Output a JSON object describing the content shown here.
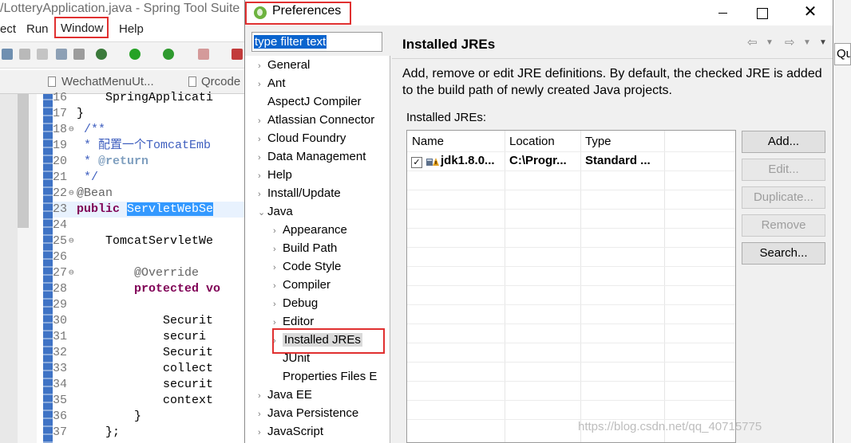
{
  "ide": {
    "title": "/LotteryApplication.java - Spring Tool Suite",
    "menu": [
      "ect",
      "Run",
      "Window",
      "Help"
    ],
    "tabs": [
      "WechatMenuUt...",
      "Qrcode"
    ],
    "code_lines": [
      {
        "n": "16",
        "text": "    SpringApplicati"
      },
      {
        "n": "17",
        "text": "}"
      },
      {
        "n": "18",
        "text": " /**"
      },
      {
        "n": "19",
        "text": " * 配置一个TomcatEmb"
      },
      {
        "n": "20",
        "text": " * @return"
      },
      {
        "n": "21",
        "text": " */"
      },
      {
        "n": "22",
        "text": "@Bean"
      },
      {
        "n": "23",
        "text": "public ServletWebSe"
      },
      {
        "n": "24",
        "text": ""
      },
      {
        "n": "25",
        "text": "    TomcatServletWe"
      },
      {
        "n": "26",
        "text": ""
      },
      {
        "n": "27",
        "text": "        @Override"
      },
      {
        "n": "28",
        "text": "        protected vo"
      },
      {
        "n": "29",
        "text": ""
      },
      {
        "n": "30",
        "text": "            Securit"
      },
      {
        "n": "31",
        "text": "            securi"
      },
      {
        "n": "32",
        "text": "            Securit"
      },
      {
        "n": "33",
        "text": "            collect"
      },
      {
        "n": "34",
        "text": "            securit"
      },
      {
        "n": "35",
        "text": "            context"
      },
      {
        "n": "36",
        "text": "        }"
      },
      {
        "n": "37",
        "text": "    };"
      }
    ],
    "quick_access": "Qu"
  },
  "dialog": {
    "title": "Preferences",
    "close_glyph": "✕",
    "filter_placeholder": "type filter text",
    "tree": [
      {
        "label": "General",
        "level": 0,
        "arrow": "›"
      },
      {
        "label": "Ant",
        "level": 0,
        "arrow": "›"
      },
      {
        "label": "AspectJ Compiler",
        "level": 0,
        "arrow": ""
      },
      {
        "label": "Atlassian Connector",
        "level": 0,
        "arrow": "›"
      },
      {
        "label": "Cloud Foundry",
        "level": 0,
        "arrow": "›"
      },
      {
        "label": "Data Management",
        "level": 0,
        "arrow": "›"
      },
      {
        "label": "Help",
        "level": 0,
        "arrow": "›"
      },
      {
        "label": "Install/Update",
        "level": 0,
        "arrow": "›"
      },
      {
        "label": "Java",
        "level": 0,
        "arrow": "⌄"
      },
      {
        "label": "Appearance",
        "level": 1,
        "arrow": "›"
      },
      {
        "label": "Build Path",
        "level": 1,
        "arrow": "›"
      },
      {
        "label": "Code Style",
        "level": 1,
        "arrow": "›"
      },
      {
        "label": "Compiler",
        "level": 1,
        "arrow": "›"
      },
      {
        "label": "Debug",
        "level": 1,
        "arrow": "›"
      },
      {
        "label": "Editor",
        "level": 1,
        "arrow": "›"
      },
      {
        "label": "Installed JREs",
        "level": 1,
        "arrow": "›",
        "selected": true
      },
      {
        "label": "JUnit",
        "level": 1,
        "arrow": ""
      },
      {
        "label": "Properties Files E",
        "level": 1,
        "arrow": ""
      },
      {
        "label": "Java EE",
        "level": 0,
        "arrow": "›"
      },
      {
        "label": "Java Persistence",
        "level": 0,
        "arrow": "›"
      },
      {
        "label": "JavaScript",
        "level": 0,
        "arrow": "›"
      }
    ],
    "page": {
      "title": "Installed JREs",
      "description": "Add, remove or edit JRE definitions. By default, the checked JRE is added to the build path of newly created Java projects.",
      "table_label": "Installed JREs:",
      "columns": [
        "Name",
        "Location",
        "Type"
      ],
      "rows": [
        {
          "checked": true,
          "name": "jdk1.8.0...",
          "location": "C:\\Progr...",
          "type": "Standard ..."
        }
      ],
      "buttons": [
        {
          "label": "Add...",
          "enabled": true
        },
        {
          "label": "Edit...",
          "enabled": false
        },
        {
          "label": "Duplicate...",
          "enabled": false
        },
        {
          "label": "Remove",
          "enabled": false
        },
        {
          "label": "Search...",
          "enabled": true
        }
      ]
    }
  },
  "watermark": "https://blog.csdn.net/qq_40715775"
}
